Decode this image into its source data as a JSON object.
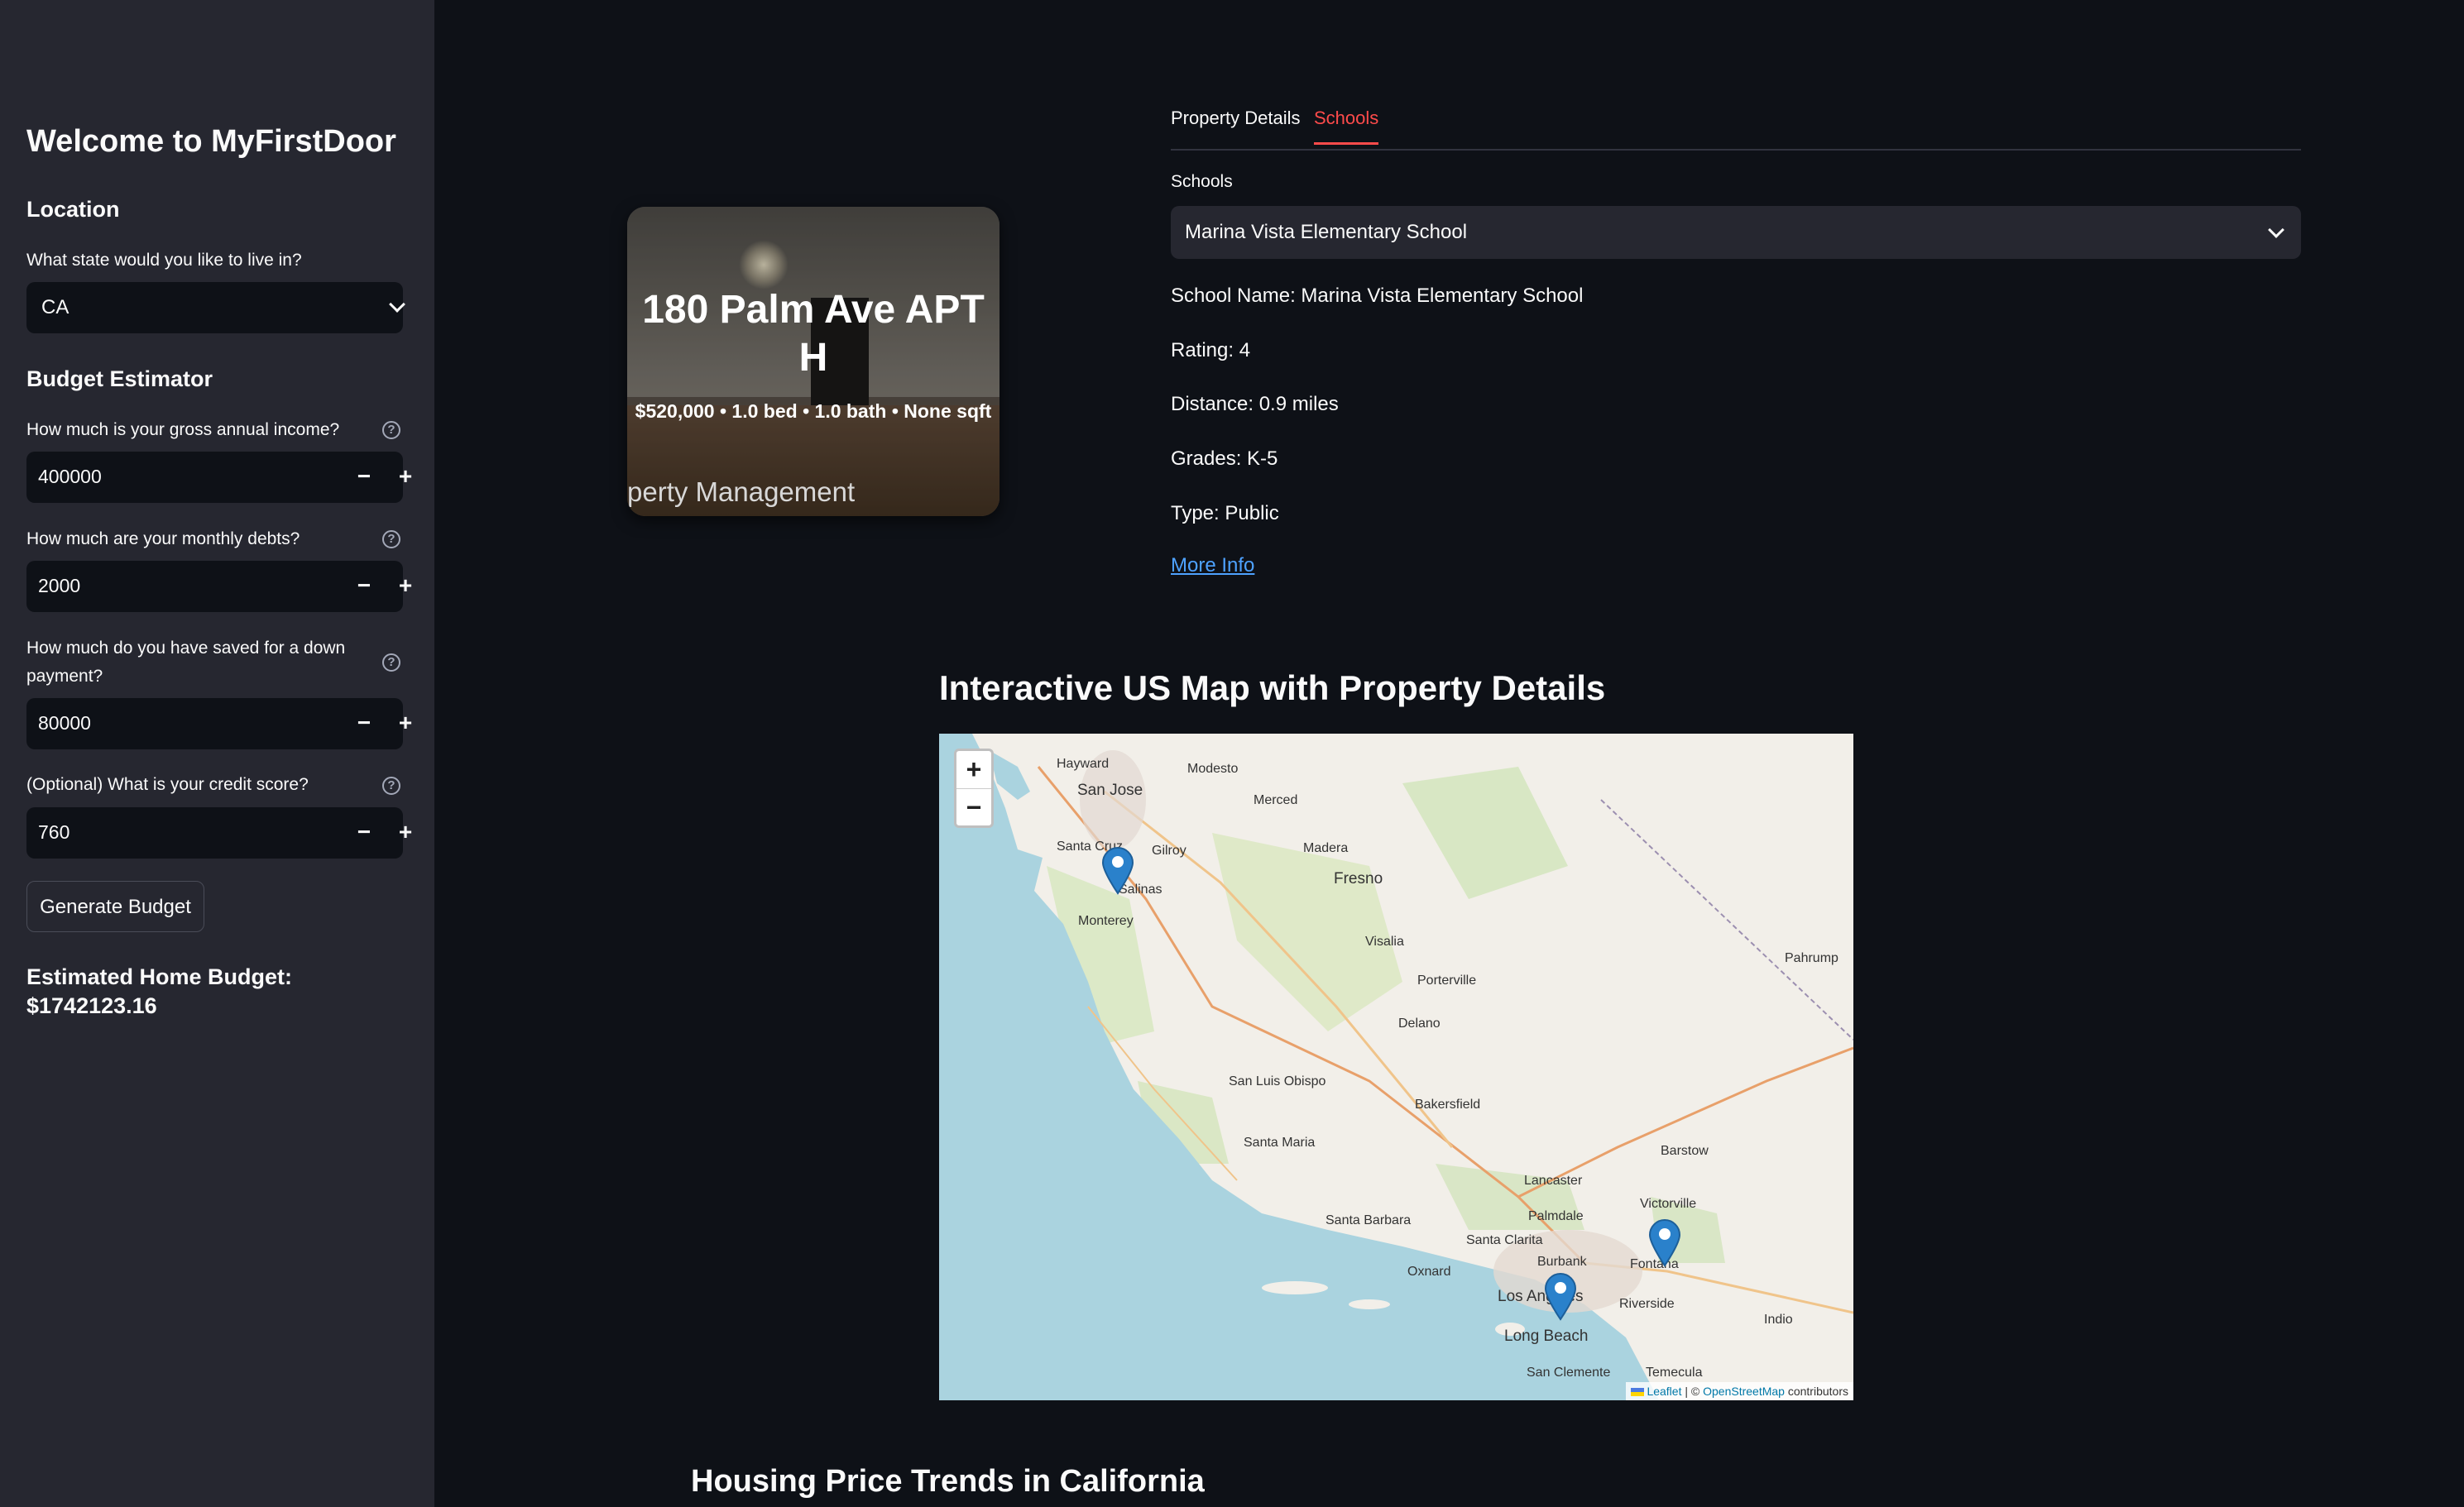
{
  "sidebar": {
    "title": "Welcome to MyFirstDoor",
    "location_heading": "Location",
    "state_label": "What state would you like to live in?",
    "state_value": "CA",
    "budget_heading": "Budget Estimator",
    "income_label": "How much is your gross annual income?",
    "income_value": "400000",
    "debts_label": "How much are your monthly debts?",
    "debts_value": "2000",
    "savings_label": "How much do you have saved for a down payment?",
    "savings_value": "80000",
    "credit_label": "(Optional) What is your credit score?",
    "credit_value": "760",
    "minus": "−",
    "plus": "+",
    "help": "?",
    "generate_button": "Generate Budget",
    "estimate_label": "Estimated Home Budget:",
    "estimate_value": "$1742123.16"
  },
  "property_card": {
    "title": "180 Palm Ave APT H",
    "subtitle": "$520,000 • 1.0 bed • 1.0 bath • None sqft",
    "footer_text": "perty Management"
  },
  "tabs": [
    "Property Details",
    "Schools"
  ],
  "active_tab": "Schools",
  "schools": {
    "label": "Schools",
    "selected": "Marina Vista Elementary School",
    "school_name": "School Name: Marina Vista Elementary School",
    "rating": "Rating: 4",
    "distance": "Distance: 0.9 miles",
    "grades": "Grades: K-5",
    "type": "Type: Public",
    "more_info": "More Info"
  },
  "map": {
    "heading": "Interactive US Map with Property Details",
    "zoom_in": "+",
    "zoom_out": "−",
    "labels": [
      "Hayward",
      "Modesto",
      "San Jose",
      "Merced",
      "Santa Cruz",
      "Gilroy",
      "Madera",
      "Salinas",
      "Fresno",
      "Monterey",
      "Visalia",
      "Porterville",
      "Pahrump",
      "Delano",
      "San Luis Obispo",
      "Bakersfield",
      "Santa Maria",
      "Barstow",
      "Lancaster",
      "Victorville",
      "Palmdale",
      "Santa Barbara",
      "Santa Clarita",
      "Burbank",
      "Fontana",
      "Oxnard",
      "Los Angeles",
      "Riverside",
      "Long Beach",
      "Indio",
      "San Clemente",
      "Temecula"
    ],
    "attribution_leaflet": "Leaflet",
    "attribution_sep": " | © ",
    "attribution_osm": "OpenStreetMap",
    "attribution_tail": " contributors",
    "colors": {
      "water": "#aad3df",
      "land": "#f2efe9",
      "park": "#cde4b4",
      "marker": "#2a81cb"
    }
  },
  "trends_heading": "Housing Price Trends in California"
}
